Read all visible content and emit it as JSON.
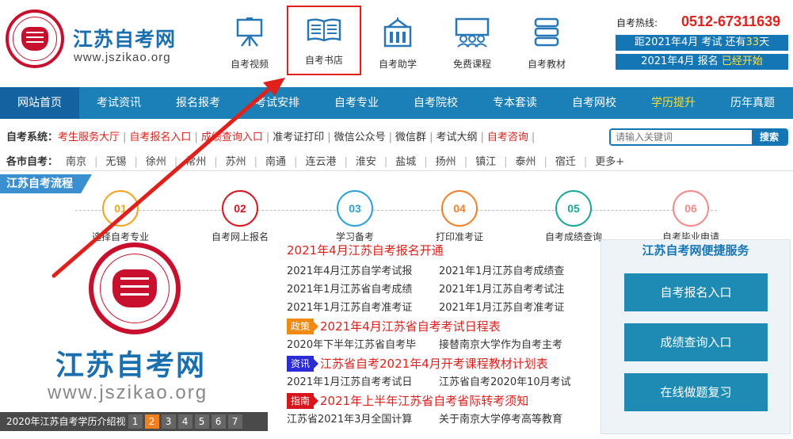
{
  "site": {
    "title": "江苏自考网",
    "url": "www.jszikao.org"
  },
  "header_nav": [
    {
      "label": "自考视频",
      "icon": "easel-icon"
    },
    {
      "label": "自考书店",
      "icon": "book-icon"
    },
    {
      "label": "自考助学",
      "icon": "building-icon"
    },
    {
      "label": "免费课程",
      "icon": "classroom-icon"
    },
    {
      "label": "自考教材",
      "icon": "books-stack-icon"
    }
  ],
  "hotline": {
    "label": "自考热线:",
    "number": "0512-67311639"
  },
  "countdown": {
    "prefix": "距2021年4月 考试 还有",
    "days": "33",
    "suffix": "天"
  },
  "registration": {
    "prefix": "2021年4月 报名",
    "status": "已经开始"
  },
  "main_nav": [
    "网站首页",
    "考试资讯",
    "报名报考",
    "考试安排",
    "自考专业",
    "自考院校",
    "专本套读",
    "自考网校",
    "学历提升",
    "历年真题"
  ],
  "quick_links": {
    "label": "自考系统：",
    "items": [
      {
        "text": "考生服务大厅",
        "red": true
      },
      {
        "text": "自考报名入口",
        "red": true
      },
      {
        "text": "成绩查询入口",
        "red": true
      },
      {
        "text": "准考证打印",
        "red": false
      },
      {
        "text": "微信公众号",
        "red": false
      },
      {
        "text": "微信群",
        "red": false
      },
      {
        "text": "考试大纲",
        "red": false
      },
      {
        "text": "自考咨询",
        "red": true
      }
    ]
  },
  "search": {
    "placeholder": "请输入关键词",
    "button": "搜索"
  },
  "cities": {
    "label": "各市自考：",
    "items": [
      "南京",
      "无锡",
      "徐州",
      "常州",
      "苏州",
      "南通",
      "连云港",
      "淮安",
      "盐城",
      "扬州",
      "镇江",
      "泰州",
      "宿迁",
      "更多+"
    ]
  },
  "process": {
    "title": "江苏自考流程",
    "steps": [
      {
        "num": "01",
        "caption": "选择自考专业",
        "color": "#f2a51c"
      },
      {
        "num": "02",
        "caption": "自考网上报名",
        "color": "#d8141c"
      },
      {
        "num": "03",
        "caption": "学习备考",
        "color": "#2a9fd8"
      },
      {
        "num": "04",
        "caption": "打印准考证",
        "color": "#f0802a"
      },
      {
        "num": "05",
        "caption": "自考成绩查询",
        "color": "#1aa89a"
      },
      {
        "num": "06",
        "caption": "自考毕业申请",
        "color": "#f28a8a"
      }
    ]
  },
  "promo": {
    "title": "江苏自考网",
    "url": "www.jszikao.org",
    "bar_text": "2020年江苏自考学历介绍视",
    "pages": [
      "1",
      "2",
      "3",
      "4",
      "5",
      "6",
      "7"
    ],
    "active_page": "2"
  },
  "news": {
    "headline": "2021年4月江苏自考报名开通",
    "rows1": [
      [
        "2021年4月江苏自学考试报",
        "2021年1月江苏自考成绩查"
      ],
      [
        "2021年1月江苏省自考成绩",
        "2021年1月江苏自考考试注"
      ],
      [
        "2021年1月江苏自考准考证",
        "2021年1月江苏自考准考证"
      ]
    ],
    "tag1": {
      "tag": "政策",
      "title": "2021年4月江苏省自考考试日程表"
    },
    "rows2": [
      [
        "2020年下半年江苏省自考毕",
        "接替南京大学作为自考主考"
      ]
    ],
    "tag2": {
      "tag": "资讯",
      "title": "江苏省自考2021年4月开考课程教材计划表"
    },
    "rows3": [
      [
        "2021年1月江苏自考考试日",
        "江苏省自考2020年10月考试"
      ]
    ],
    "tag3": {
      "tag": "指南",
      "title": "2021年上半年江苏省自考省际转考须知"
    },
    "rows4": [
      [
        "江苏省2021年3月全国计算",
        "关于南京大学停考高等教育"
      ]
    ]
  },
  "services": {
    "title": "江苏自考网便捷服务",
    "buttons": [
      "自考报名入口",
      "成绩查询入口",
      "在线做题复习"
    ]
  },
  "colors": {
    "brand_blue": "#1b7fb8",
    "accent_red": "#e0201b",
    "highlight_yellow": "#ffe03a"
  }
}
